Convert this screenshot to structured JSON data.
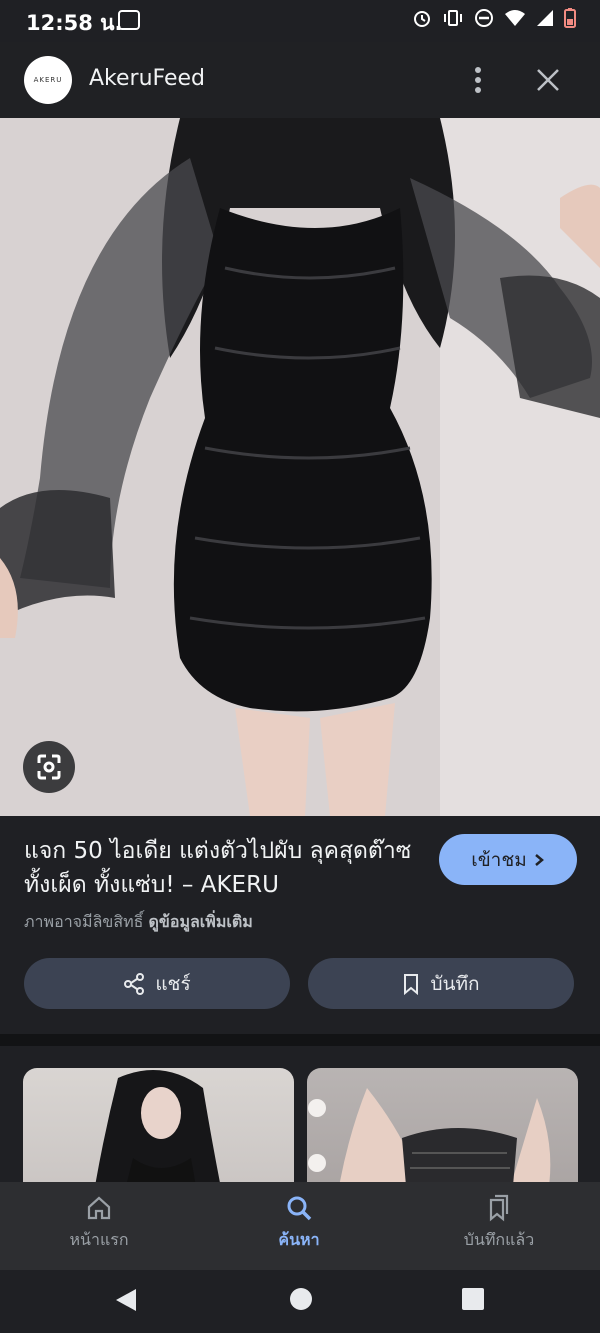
{
  "status_bar": {
    "time": "12:58 น."
  },
  "appbar": {
    "logo_text": "AKERU",
    "title": "AkeruFeed"
  },
  "result": {
    "title": "แจก 50 ไอเดีย แต่งตัวไปผับ ลุคสุดต๊าซ ทั้งเผ็ด ทั้งแซ่บ! – AKERU",
    "visit_label": "เข้าชม",
    "copyright_text": "ภาพอาจมีลิขสิทธิ์",
    "more_info_label": "ดูข้อมูลเพิ่มเติม",
    "share_label": "แชร์",
    "save_label": "บันทึก"
  },
  "bottom_nav": {
    "items": [
      {
        "label": "หน้าแรก",
        "icon": "home-icon"
      },
      {
        "label": "ค้นหา",
        "icon": "search-icon",
        "active": true
      },
      {
        "label": "บันทึกแล้ว",
        "icon": "saved-icon"
      }
    ]
  },
  "colors": {
    "accent": "#8ab4f8",
    "background": "#1f2024",
    "button": "#3c4353"
  }
}
